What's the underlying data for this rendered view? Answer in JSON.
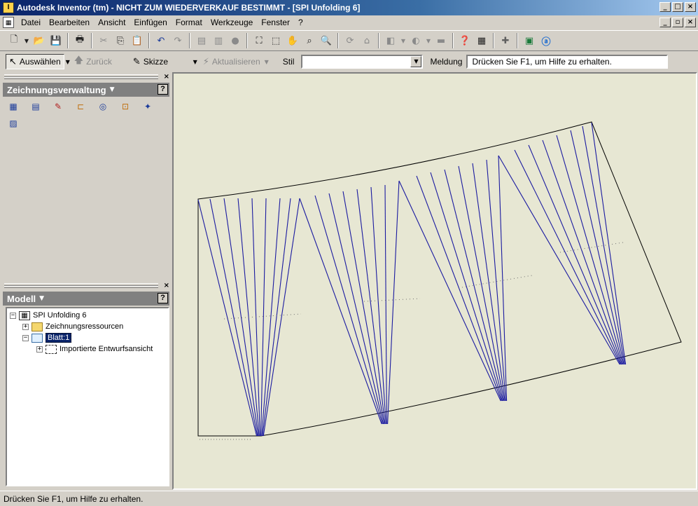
{
  "window": {
    "title": "Autodesk Inventor (tm) - NICHT ZUM WIEDERVERKAUF BESTIMMT - [SPI Unfolding 6]",
    "controls": [
      "_",
      "□",
      "×"
    ]
  },
  "menu": {
    "items": [
      "Datei",
      "Bearbeiten",
      "Ansicht",
      "Einfügen",
      "Format",
      "Werkzeuge",
      "Fenster",
      "?"
    ],
    "mdi_controls": [
      "_",
      "▫",
      "×"
    ]
  },
  "toolbar1": {
    "icons": [
      "new-icon",
      "open-icon",
      "save-icon",
      "print-icon",
      "cut-icon",
      "copy-icon",
      "paste-icon",
      "undo-icon",
      "redo-icon",
      "props-icon",
      "params-icon",
      "sphere-icon",
      "zoom-all-icon",
      "zoom-window-icon",
      "pan-icon",
      "zoom-icon",
      "rotate-icon",
      "look-at-icon",
      "shade-icon",
      "display-icon",
      "measure-icon",
      "help-icon",
      "calc-icon",
      "plus-icon",
      "panel-icon",
      "autodesk-icon"
    ]
  },
  "toolbar2": {
    "select_label": "Auswählen",
    "back_label": "Zurück",
    "sketch_label": "Skizze",
    "update_label": "Aktualisieren",
    "style_label": "Stil",
    "style_value": "",
    "message_label": "Meldung",
    "message_value": "Drücken Sie F1, um Hilfe zu erhalten."
  },
  "drawing_panel": {
    "title": "Zeichnungsverwaltung",
    "help": "?",
    "close": "×",
    "icons": [
      "base-view-icon",
      "projected-view-icon",
      "auxiliary-view-icon",
      "section-view-icon",
      "detail-view-icon",
      "broken-view-icon",
      "draft-view-icon",
      "sheet-icon"
    ]
  },
  "model_panel": {
    "title": "Modell",
    "help": "?",
    "close": "×",
    "tree": [
      {
        "label": "SPI Unfolding 6",
        "expander": "−",
        "icon": "drawing-icon"
      },
      {
        "label": "Zeichnungsressourcen",
        "expander": "+",
        "icon": "folder-icon"
      },
      {
        "label": "Blatt:1",
        "expander": "−",
        "icon": "sheet-icon",
        "selected": true
      },
      {
        "label": "Importierte Entwurfsansicht",
        "expander": "+",
        "icon": "view-icon"
      }
    ]
  },
  "colors": {
    "canvas_bg": "#e7e7d3",
    "fold_line": "#1a1aa0",
    "outline": "#000000"
  },
  "statusbar": {
    "text": "Drücken Sie F1, um Hilfe zu erhalten."
  }
}
